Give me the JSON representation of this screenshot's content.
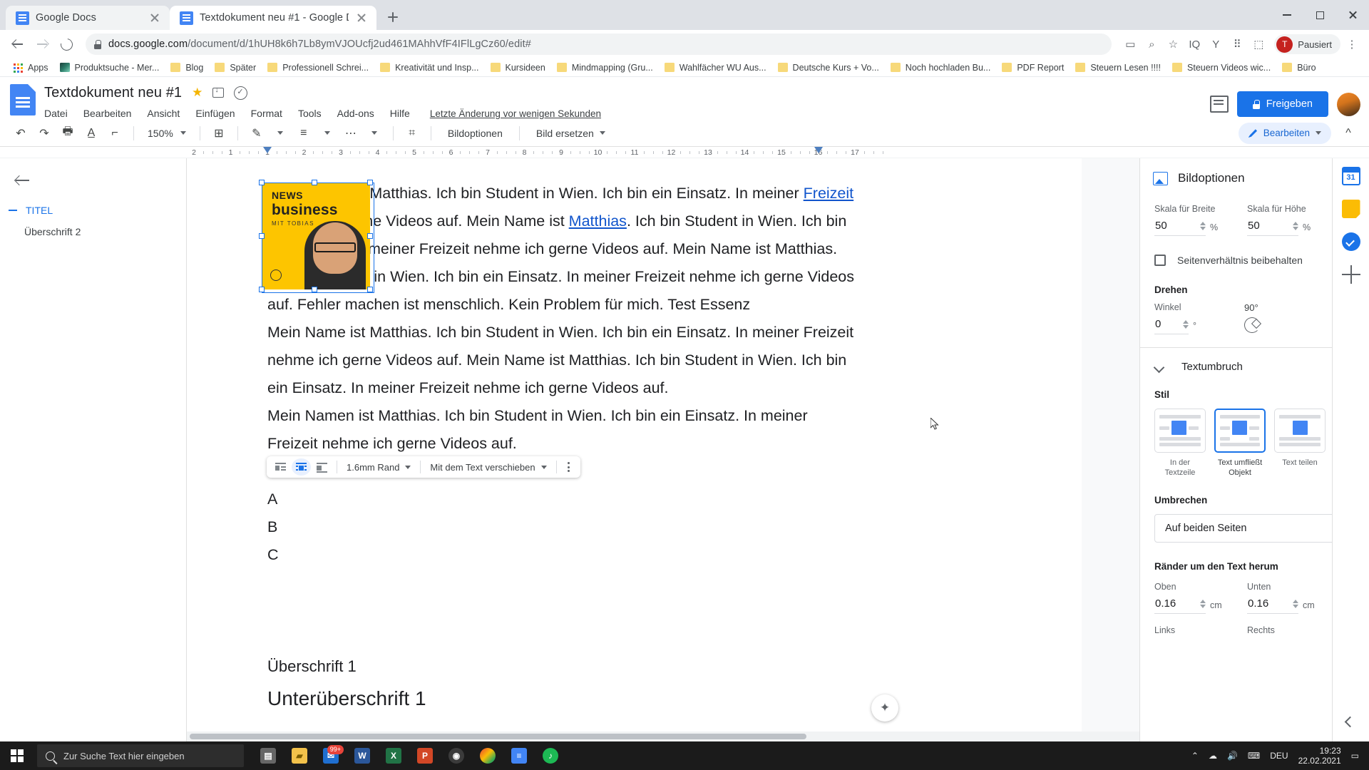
{
  "browser": {
    "tabs": [
      {
        "title": "Google Docs",
        "active": false
      },
      {
        "title": "Textdokument neu #1 - Google D",
        "active": true
      }
    ],
    "new_tab_label": "+",
    "window_buttons": {
      "minimize": "—",
      "maximize": "□",
      "close": "✕"
    },
    "url_secure_prefix": "docs.google.com",
    "url_rest": "/document/d/1hUH8k6h7Lb8ymVJOUcfj2ud461MAhhVfF4IFlLgCz60/edit#",
    "profile_name": "Pausiert",
    "profile_initial": "T",
    "bookmarks": [
      {
        "label": "Apps",
        "type": "apps"
      },
      {
        "label": "Produktsuche - Mer...",
        "type": "pic"
      },
      {
        "label": "Blog",
        "type": "folder"
      },
      {
        "label": "Später",
        "type": "folder"
      },
      {
        "label": "Professionell Schrei...",
        "type": "folder"
      },
      {
        "label": "Kreativität und Insp...",
        "type": "folder"
      },
      {
        "label": "Kursideen",
        "type": "folder"
      },
      {
        "label": "Mindmapping  (Gru...",
        "type": "folder"
      },
      {
        "label": "Wahlfächer WU Aus...",
        "type": "folder"
      },
      {
        "label": "Deutsche Kurs + Vo...",
        "type": "folder"
      },
      {
        "label": "Noch hochladen Bu...",
        "type": "folder"
      },
      {
        "label": "PDF Report",
        "type": "folder"
      },
      {
        "label": "Steuern Lesen !!!!",
        "type": "folder"
      },
      {
        "label": "Steuern Videos wic...",
        "type": "folder"
      },
      {
        "label": "Büro",
        "type": "folder"
      }
    ]
  },
  "docs": {
    "title": "Textdokument neu #1",
    "menus": [
      "Datei",
      "Bearbeiten",
      "Ansicht",
      "Einfügen",
      "Format",
      "Tools",
      "Add-ons",
      "Hilfe"
    ],
    "save_status": "Letzte Änderung vor wenigen Sekunden",
    "share_label": "Freigeben",
    "toolbar": {
      "zoom": "150%",
      "image_options_label": "Bildoptionen",
      "replace_image_label": "Bild ersetzen",
      "edit_mode_label": "Bearbeiten"
    },
    "ruler_labels": [
      "2",
      "1",
      "1",
      "2",
      "3",
      "4",
      "5",
      "6",
      "7",
      "8",
      "9",
      "10",
      "11",
      "12",
      "13",
      "14",
      "15",
      "16",
      "17"
    ],
    "outline": {
      "items": [
        {
          "label": "TITEL",
          "level": 1
        },
        {
          "label": "Überschrift 2",
          "level": 2
        }
      ]
    },
    "document": {
      "paragraph_1_pre": "Mein Name ist Matthias. Ich bin Student in Wien. Ich bin ein Einsatz. In meiner ",
      "link_1": "Freizeit",
      "paragraph_1_mid": " nehme ich gerne Videos auf. Mein Name ist ",
      "link_2": "Matthias",
      "paragraph_1_post": ". Ich bin Student in Wien. Ich bin ein Einsatz. In meiner Freizeit nehme ich gerne Videos auf. Mein Name ist Matthias. Ich bin Student in Wien. Ich bin ein Einsatz. In meiner Freizeit nehme ich gerne Videos auf. Fehler machen ist menschlich. Kein Problem für mich. Test Essenz",
      "paragraph_2": "Mein Name ist Matthias. Ich bin Student in Wien. Ich bin ein Einsatz. In meiner Freizeit nehme ich gerne Videos auf. Mein Name ist Matthias. Ich bin Student in Wien. Ich bin ein Einsatz. In meiner Freizeit nehme ich gerne Videos auf.",
      "paragraph_3": "Mein Namen ist Matthias. Ich bin Student in Wien. Ich bin ein Einsatz. In meiner Freizeit nehme ich gerne Videos auf.",
      "list_a": "A",
      "list_b": "B",
      "list_c": "C",
      "heading_1": "Überschrift 1",
      "subheading_1": "Unterüberschrift 1"
    },
    "image": {
      "text_news": "NEWS",
      "text_business": "business",
      "text_with": "MIT TOBIAS"
    },
    "image_toolbar": {
      "margin_label": "1.6mm Rand",
      "move_label": "Mit dem Text verschieben"
    }
  },
  "panel": {
    "title": "Bildoptionen",
    "scale_width_label": "Skala für Breite",
    "scale_width_value": "50",
    "scale_width_unit": "%",
    "scale_height_label": "Skala für Höhe",
    "scale_height_value": "50",
    "scale_height_unit": "%",
    "keep_ratio_label": "Seitenverhältnis beibehalten",
    "rotate_title": "Drehen",
    "angle_label": "Winkel",
    "angle_value": "0",
    "angle_unit": "°",
    "rotate_90_label": "90°",
    "wrap_section_title": "Textumbruch",
    "style_label": "Stil",
    "styles": [
      {
        "label": "In der Textzeile",
        "active": false
      },
      {
        "label": "Text umfließt Objekt",
        "active": true
      },
      {
        "label": "Text teilen",
        "active": false
      }
    ],
    "break_label": "Umbrechen",
    "break_value": "Auf beiden Seiten",
    "margins_title": "Ränder um den Text herum",
    "margin_top_label": "Oben",
    "margin_top_value": "0.16",
    "margin_bottom_label": "Unten",
    "margin_bottom_value": "0.16",
    "margin_left_label": "Links",
    "margin_right_label": "Rechts",
    "margin_unit": "cm"
  },
  "taskbar": {
    "search_placeholder": "Zur Suche Text hier eingeben",
    "mail_badge": "99+",
    "language": "DEU",
    "time": "19:23",
    "date": "22.02.2021"
  }
}
